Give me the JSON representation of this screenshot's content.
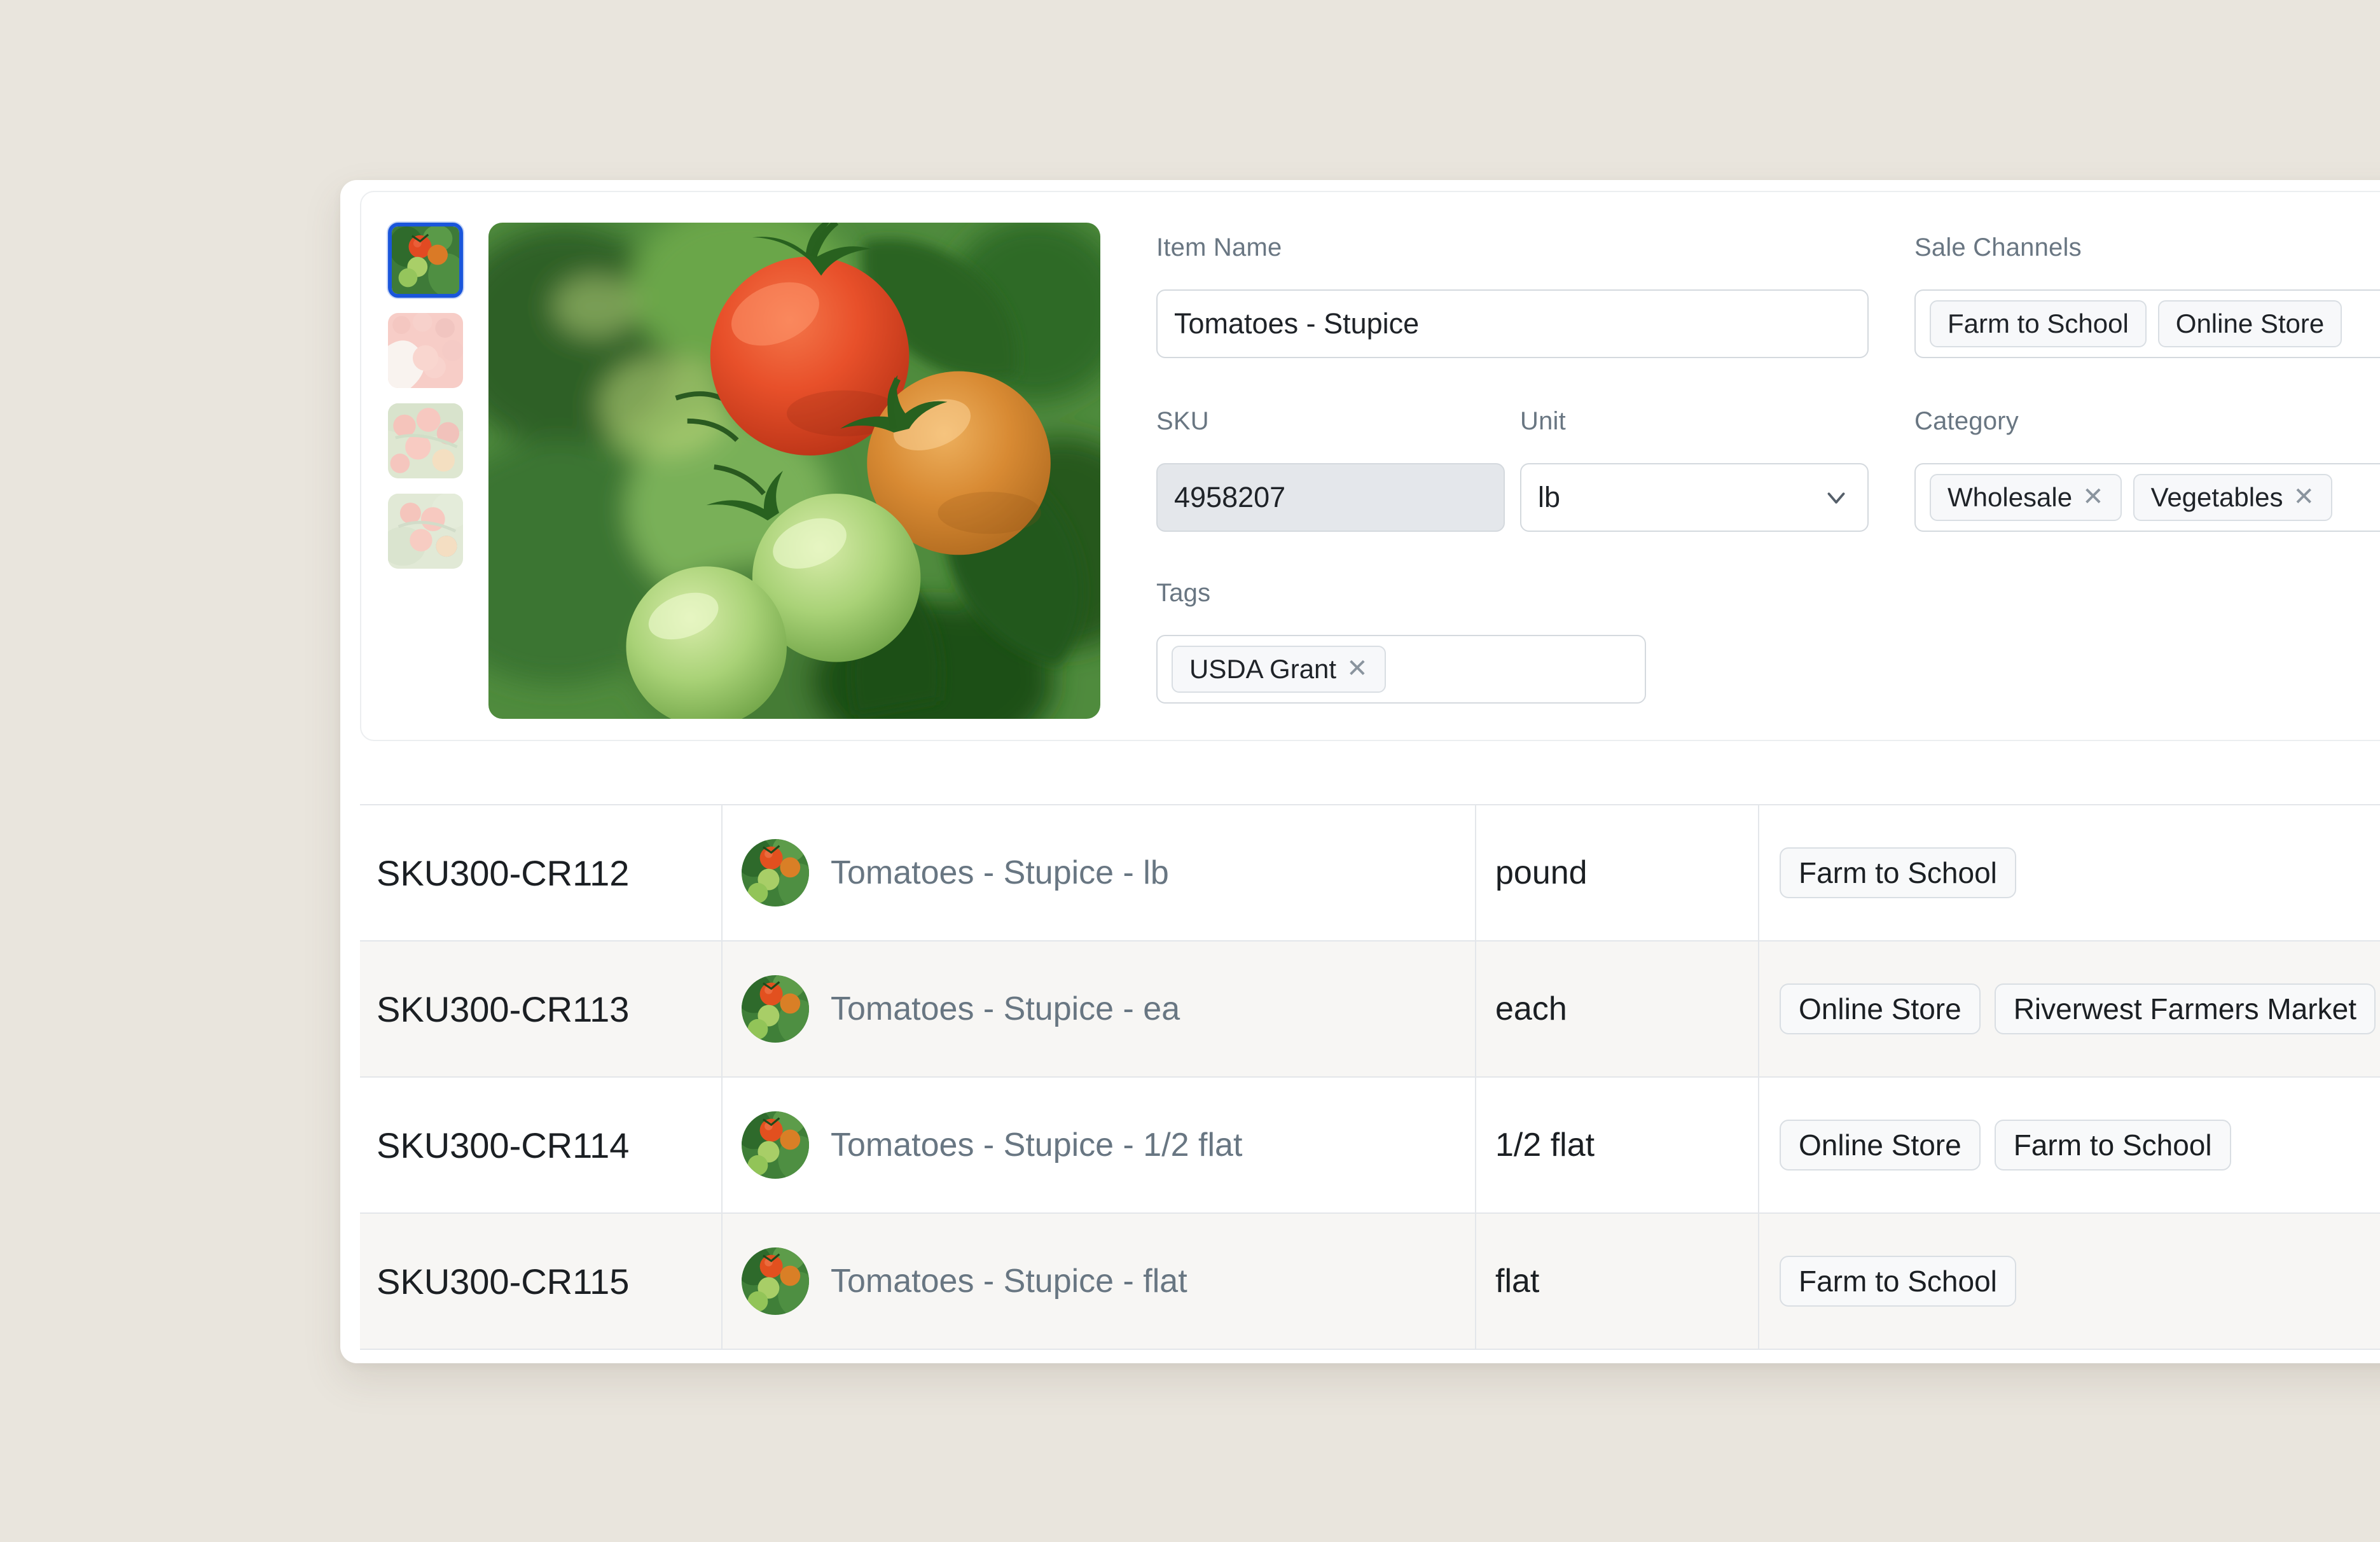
{
  "form": {
    "item_name": {
      "label": "Item Name",
      "value": "Tomatoes - Stupice"
    },
    "sku": {
      "label": "SKU",
      "value": "4958207",
      "readonly": true
    },
    "unit": {
      "label": "Unit",
      "value": "lb",
      "icon": "chevron-down-icon"
    },
    "tags": {
      "label": "Tags",
      "chips": [
        {
          "text": "USDA Grant",
          "removable": true
        }
      ]
    },
    "sale_channels": {
      "label": "Sale Channels",
      "chips": [
        {
          "text": "Farm to School",
          "removable": false
        },
        {
          "text": "Online Store",
          "removable": false
        }
      ]
    },
    "category": {
      "label": "Category",
      "chips": [
        {
          "text": "Wholesale",
          "removable": true
        },
        {
          "text": "Vegetables",
          "removable": true
        }
      ]
    }
  },
  "gallery": {
    "thumbnails": [
      {
        "name": "tomatoes-on-vine",
        "selected": true
      },
      {
        "name": "hand-holding-tomatoes",
        "selected": false
      },
      {
        "name": "cluster-of-red-tomatoes",
        "selected": false
      },
      {
        "name": "ripe-tomatoes-on-branch",
        "selected": false
      }
    ],
    "hero": {
      "name": "tomatoes-ripening-on-vine"
    }
  },
  "table": {
    "rows": [
      {
        "sku": "SKU300-CR112",
        "name": "Tomatoes - Stupice - lb",
        "unit": "pound",
        "channels": [
          "Farm to School"
        ]
      },
      {
        "sku": "SKU300-CR113",
        "name": "Tomatoes - Stupice - ea",
        "unit": "each",
        "channels": [
          "Online Store",
          "Riverwest Farmers Market"
        ]
      },
      {
        "sku": "SKU300-CR114",
        "name": "Tomatoes - Stupice - 1/2 flat",
        "unit": "1/2 flat",
        "channels": [
          "Online Store",
          "Farm to School"
        ]
      },
      {
        "sku": "SKU300-CR115",
        "name": "Tomatoes - Stupice - flat",
        "unit": "flat",
        "channels": [
          "Farm to School"
        ]
      }
    ]
  },
  "colors": {
    "page_background": "#e9e5dd",
    "panel": "#ffffff",
    "selection_blue": "#1a56db",
    "label_gray": "#697682",
    "row_alt": "#f7f6f4",
    "border": "#e3e6ea"
  }
}
